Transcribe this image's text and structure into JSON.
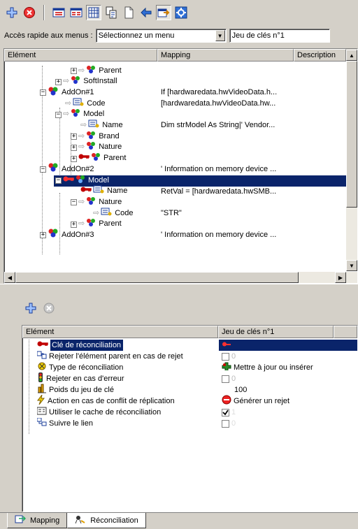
{
  "toolbar": {
    "buttons": [
      "add-icon",
      "delete-icon",
      "view-list-icon",
      "view-detail-icon",
      "grid-icon",
      "copy-icon",
      "new-page-icon",
      "arrow-icon",
      "export-icon",
      "settings-icon"
    ]
  },
  "quick_access": {
    "label": "Accès rapide aux menus :",
    "menu_value": "Sélectionnez un menu",
    "keyset_value": "Jeu de clés n°1"
  },
  "tree": {
    "columns": [
      "Elément",
      "Mapping",
      "Description"
    ],
    "rows": [
      {
        "label": "Parent",
        "mapping": ""
      },
      {
        "label": "SoftInstall",
        "mapping": ""
      },
      {
        "label": "AddOn#1",
        "mapping": "If [hardwaredata.hwVideoData.h..."
      },
      {
        "label": "Code",
        "mapping": "[hardwaredata.hwVideoData.hw..."
      },
      {
        "label": "Model",
        "mapping": ""
      },
      {
        "label": "Name",
        "mapping": "Dim strModel As String|' Vendor..."
      },
      {
        "label": "Brand",
        "mapping": ""
      },
      {
        "label": "Nature",
        "mapping": ""
      },
      {
        "label": "Parent",
        "mapping": ""
      },
      {
        "label": "AddOn#2",
        "mapping": "' Information on memory device ..."
      },
      {
        "label": "Model",
        "mapping": ""
      },
      {
        "label": "Name",
        "mapping": "RetVal = [hardwaredata.hwSMB..."
      },
      {
        "label": "Nature",
        "mapping": ""
      },
      {
        "label": "Code",
        "mapping": "\"STR\""
      },
      {
        "label": "Parent",
        "mapping": ""
      },
      {
        "label": "AddOn#3",
        "mapping": "' Information on memory device ..."
      }
    ]
  },
  "lower": {
    "columns": [
      "Elément",
      "Jeu de clés n°1"
    ],
    "rows": [
      {
        "label": "Clé de réconciliation",
        "value": ""
      },
      {
        "label": "Rejeter l'élément parent en cas de rejet",
        "value": "0"
      },
      {
        "label": "Type de réconciliation",
        "value": "Mettre à jour ou insérer"
      },
      {
        "label": "Rejeter en cas d'erreur",
        "value": "0"
      },
      {
        "label": "Poids du jeu de clé",
        "value": "100"
      },
      {
        "label": "Action en cas de conflit de réplication",
        "value": "Générer un rejet"
      },
      {
        "label": "Utiliser le cache de réconciliation",
        "value": "1"
      },
      {
        "label": "Suivre le lien",
        "value": "0"
      }
    ]
  },
  "tabs": [
    "Mapping",
    "Réconciliation"
  ],
  "colors": {
    "selection": "#0a246a",
    "face": "#d4d0c8",
    "key_red": "#c00000"
  }
}
